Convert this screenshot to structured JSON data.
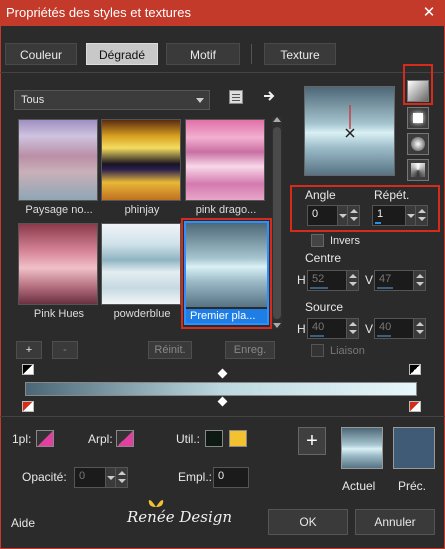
{
  "window": {
    "title": "Propriétés des styles et textures",
    "close_glyph": "✕"
  },
  "tabs": [
    {
      "label": "Couleur"
    },
    {
      "label": "Dégradé"
    },
    {
      "label": "Motif"
    },
    {
      "label": "Texture"
    }
  ],
  "category": {
    "selected": "Tous"
  },
  "gradients": [
    {
      "name": "Paysage no...",
      "gradient": "linear-gradient(to bottom,#9f8fc0 0%,#cfc3e0 20%,#b98fa6 45%,#c9b0b8 65%,#8ea6b5 100%)"
    },
    {
      "name": "phinjay",
      "gradient": "linear-gradient(to bottom,#5a2b10 0%,#d8a020 20%,#f4dc60 35%,#1a1420 55%,#2a2050 62%,#e8b838 78%,#c07020 100%)"
    },
    {
      "name": "pink drago...",
      "gradient": "linear-gradient(to bottom,#e070a8 0%,#f2b0d0 22%,#c96fa3 40%,#f8d8e8 58%,#d47ab0 80%,#e8a6c8 100%)"
    },
    {
      "name": "Pink Hues",
      "gradient": "linear-gradient(to bottom,#8a3a4a 0%,#d8889a 35%,#f0c0c8 55%,#b06a7a 80%,#6a3040 100%)"
    },
    {
      "name": "powderblue",
      "gradient": "linear-gradient(to bottom,#f0f4f8 0%,#d0e2ea 25%,#8fb4c2 45%,#e4eef2 60%,#c6d9e1 80%,#f2f6f8 100%)"
    },
    {
      "name": "Premier pla...",
      "gradient": "linear-gradient(to bottom,#4d6777 0%,#a6c5cf 42%,#d9f0f4 52%,#9ab9c6 70%,#577384 100%)"
    }
  ],
  "buttons": {
    "add": "+",
    "remove": "-",
    "reset": "Réinit.",
    "save": "Enreg."
  },
  "style_icons": [
    "linear-style-icon",
    "rectangular-style-icon",
    "sunburst-style-icon",
    "radial-style-icon"
  ],
  "angle": {
    "label": "Angle",
    "value": "0"
  },
  "repeat": {
    "label": "Répét.",
    "value": "1"
  },
  "invert": {
    "label": "Invers"
  },
  "center": {
    "label": "Centre",
    "h_label": "H",
    "h_value": "52",
    "v_label": "V",
    "v_value": "47"
  },
  "source": {
    "label": "Source",
    "h_label": "H",
    "h_value": "40",
    "v_label": "V",
    "v_value": "40"
  },
  "link": {
    "label": "Liaison"
  },
  "stops": {
    "fg_label": "1pl:",
    "bg_label": "Arpl:",
    "user_label": "Util.:",
    "user_colors": [
      "#0d1a12",
      "#f2c231"
    ],
    "opacity_label": "Opacité:",
    "opacity_value": "0",
    "location_label": "Empl.:",
    "location_value": "0"
  },
  "current": {
    "label": "Actuel",
    "color": "linear-gradient(to bottom,#4d6777 0%,#a6c5cf 42%,#d9f0f4 52%,#9ab9c6 70%,#577384 100%)"
  },
  "previous": {
    "label": "Préc.",
    "color": "#3f5b75"
  },
  "watermark": "Renée Design",
  "footer": {
    "help": "Aide",
    "ok": "OK",
    "cancel": "Annuler"
  },
  "colors": {
    "titlebar": "#c33a2a",
    "highlight_red": "#d62a1a",
    "accent_blue": "#2f8fff",
    "pink_swatch": "#e040a0"
  }
}
